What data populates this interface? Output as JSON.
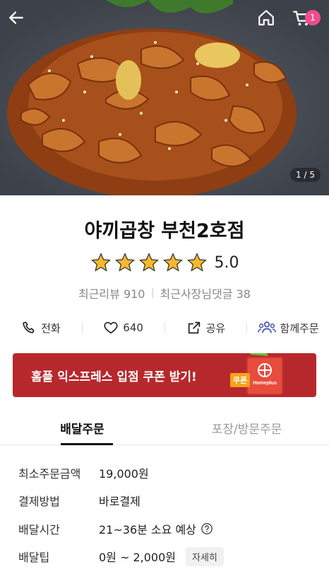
{
  "hero": {
    "image_counter": "1 / 5",
    "cart_count": "1"
  },
  "store": {
    "name": "야끼곱창 부천2호점",
    "rating": "5.0",
    "stars_filled": 5,
    "recent_reviews": "최근리뷰 910",
    "recent_owner_replies": "최근사장님댓글 38"
  },
  "actions": {
    "call": "전화",
    "likes": "640",
    "share": "공유",
    "group_order": "함께주문"
  },
  "banner": {
    "text": "홈플 익스프레스 입점 쿠폰 받기!",
    "art_text": "쿠폰",
    "brand_mark": "Homeplus",
    "accent_color": "#b7282d"
  },
  "tabs": [
    {
      "label": "배달주문",
      "active": true
    },
    {
      "label": "포장/방문주문",
      "active": false
    }
  ],
  "info": {
    "min_order_label": "최소주문금액",
    "min_order_value": "19,000원",
    "payment_label": "결제방법",
    "payment_value": "바로결제",
    "delivery_time_label": "배달시간",
    "delivery_time_value": "21~36분 소요 예상",
    "tip_label": "배달팁",
    "tip_value": "0원 ~ 2,000원",
    "tip_detail": "자세히"
  },
  "icons": {
    "back": "arrow-left-icon",
    "home": "home-icon",
    "cart": "cart-icon",
    "phone": "phone-icon",
    "heart": "heart-icon",
    "share": "share-icon",
    "group": "group-icon",
    "help": "question-circle-icon",
    "star": "star-icon"
  }
}
